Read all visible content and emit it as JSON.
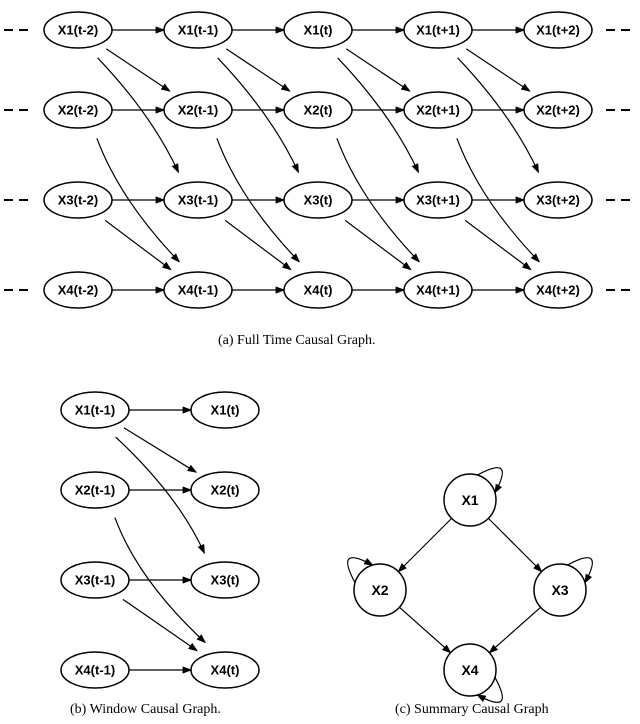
{
  "captions": {
    "a": "(a)  Full Time Causal Graph.",
    "b": "(b)  Window Causal Graph.",
    "c": "(c)  Summary Causal Graph"
  },
  "full_graph": {
    "vars": [
      "X1",
      "X2",
      "X3",
      "X4"
    ],
    "times": [
      "t-2",
      "t-1",
      "t",
      "t+1",
      "t+2"
    ],
    "edges_within_column": [
      [
        "X1",
        "X2"
      ],
      [
        "X1",
        "X3"
      ],
      [
        "X3",
        "X4"
      ]
    ],
    "edges_lag1": [
      [
        "X1",
        "X1"
      ],
      [
        "X2",
        "X2"
      ],
      [
        "X3",
        "X3"
      ],
      [
        "X4",
        "X4"
      ],
      [
        "X1",
        "X2"
      ],
      [
        "X1",
        "X3"
      ],
      [
        "X2",
        "X4"
      ],
      [
        "X3",
        "X4"
      ]
    ]
  },
  "window_graph": {
    "vars": [
      "X1",
      "X2",
      "X3",
      "X4"
    ],
    "times": [
      "t-1",
      "t"
    ],
    "edges": [
      [
        "X1(t-1)",
        "X1(t)"
      ],
      [
        "X2(t-1)",
        "X2(t)"
      ],
      [
        "X3(t-1)",
        "X3(t)"
      ],
      [
        "X4(t-1)",
        "X4(t)"
      ],
      [
        "X1(t-1)",
        "X2(t)"
      ],
      [
        "X1(t-1)",
        "X3(t)"
      ],
      [
        "X2(t-1)",
        "X4(t)"
      ],
      [
        "X3(t-1)",
        "X4(t)"
      ]
    ]
  },
  "summary_graph": {
    "nodes": [
      "X1",
      "X2",
      "X3",
      "X4"
    ],
    "edges": [
      [
        "X1",
        "X2"
      ],
      [
        "X1",
        "X3"
      ],
      [
        "X2",
        "X4"
      ],
      [
        "X3",
        "X4"
      ]
    ],
    "self_loops": [
      "X1",
      "X2",
      "X3",
      "X4"
    ]
  }
}
